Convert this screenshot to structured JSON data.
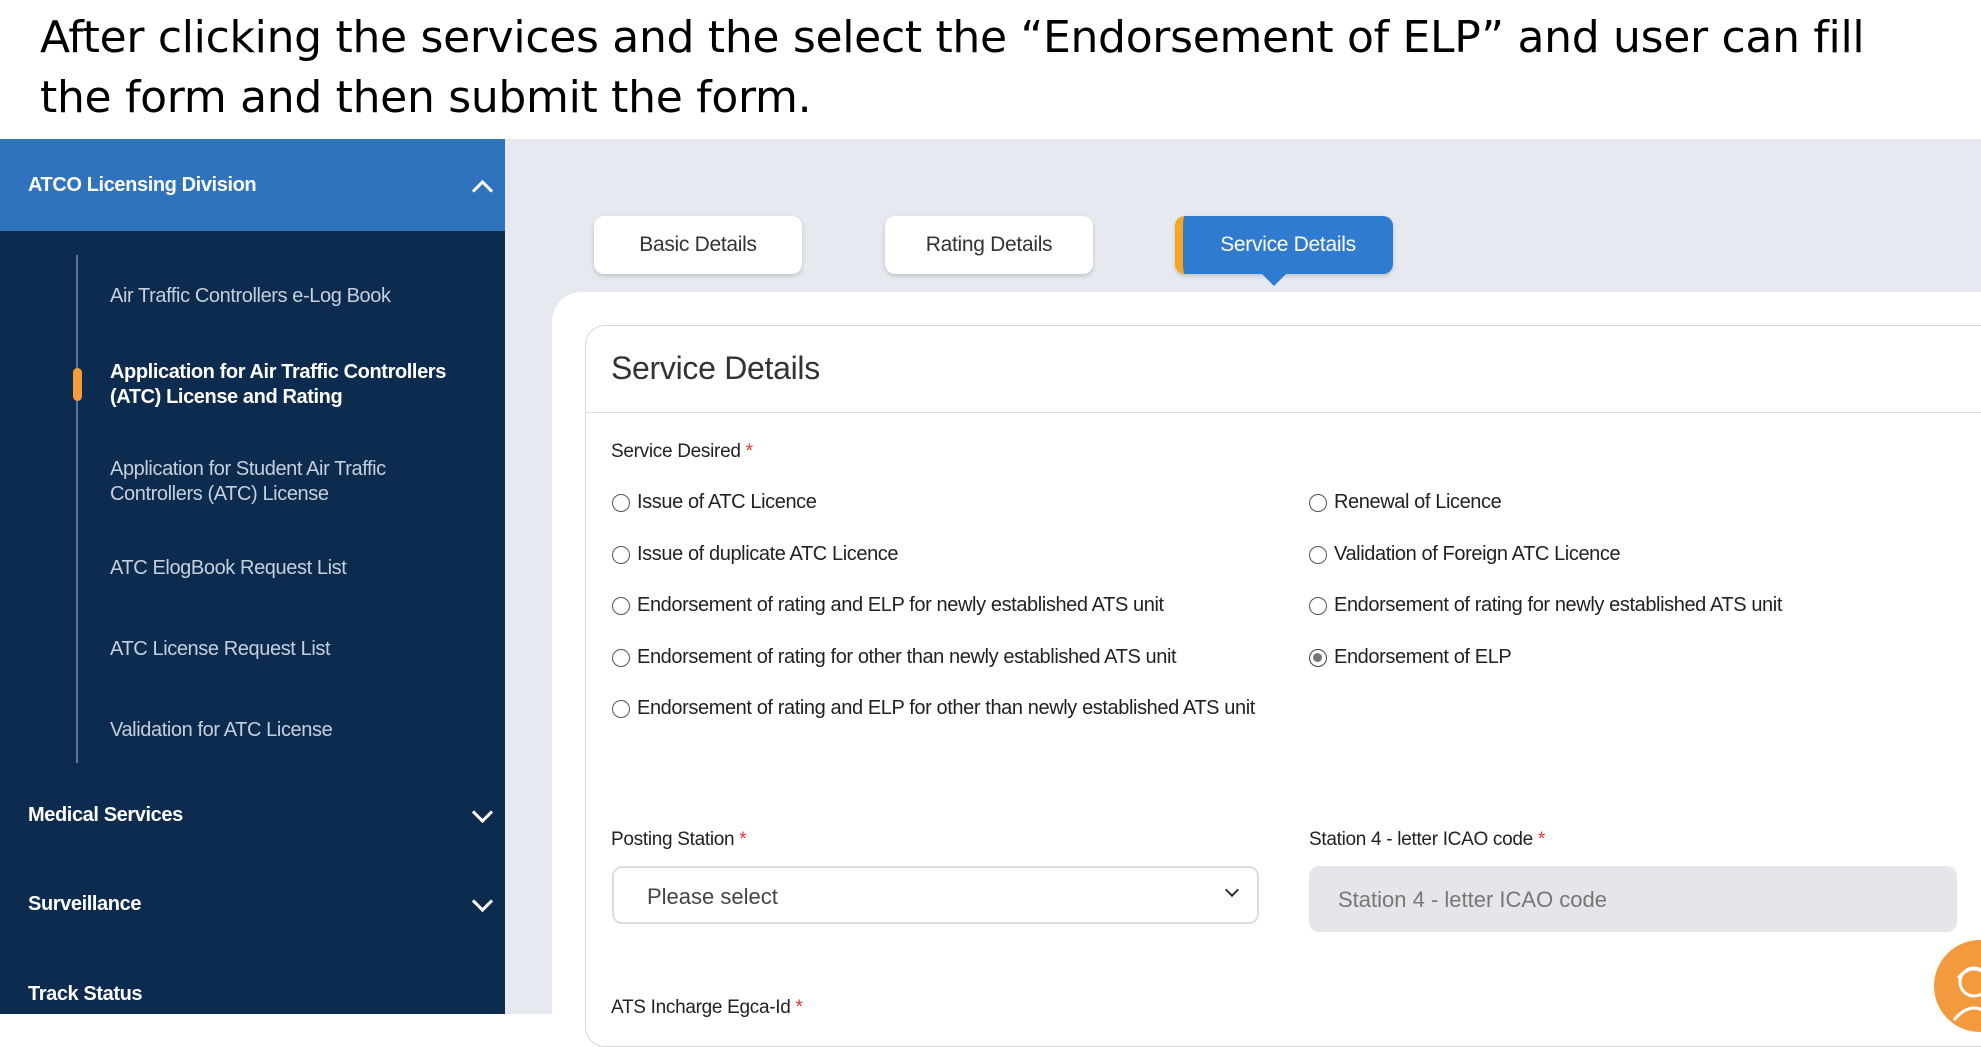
{
  "caption": "After clicking the services and the select the “Endorsement of ELP” and user can fill the form and then submit the form.",
  "sidebar": {
    "section_title": "ATCO Licensing Division",
    "sub_items": [
      {
        "label": "Air Traffic Controllers e-Log Book",
        "active": false
      },
      {
        "label": "Application for Air Traffic Controllers (ATC) License and Rating",
        "active": true
      },
      {
        "label": "Application for Student Air Traffic Controllers (ATC) License",
        "active": false
      },
      {
        "label": "ATC ElogBook Request List",
        "active": false
      },
      {
        "label": "ATC License Request List",
        "active": false
      },
      {
        "label": "Validation for ATC License",
        "active": false
      }
    ],
    "items": [
      {
        "label": "Medical Services"
      },
      {
        "label": "Surveillance"
      },
      {
        "label": "Track Status"
      }
    ]
  },
  "tabs": [
    {
      "label": "Basic Details",
      "active": false
    },
    {
      "label": "Rating Details",
      "active": false
    },
    {
      "label": "Service Details",
      "active": true
    }
  ],
  "form": {
    "title": "Service Details",
    "service_desired_label": "Service Desired",
    "required_mark": "*",
    "options": [
      {
        "label": "Issue of ATC Licence",
        "checked": false
      },
      {
        "label": "Renewal of Licence",
        "checked": false
      },
      {
        "label": "Issue of duplicate ATC Licence",
        "checked": false
      },
      {
        "label": "Validation of Foreign ATC Licence",
        "checked": false
      },
      {
        "label": "Endorsement of rating and ELP for newly established ATS unit",
        "checked": false
      },
      {
        "label": "Endorsement of rating for newly established ATS unit",
        "checked": false
      },
      {
        "label": "Endorsement of rating for other than newly established ATS unit",
        "checked": false
      },
      {
        "label": "Endorsement of ELP",
        "checked": true
      },
      {
        "label": "Endorsement of rating and ELP for other than newly established ATS unit",
        "checked": false
      }
    ],
    "posting_station_label": "Posting Station",
    "posting_station_value": "Please select",
    "icao_label": "Station 4 - letter ICAO code",
    "icao_placeholder": "Station 4 - letter ICAO code",
    "ats_incharge_label": "ATS Incharge Egca-Id"
  },
  "colors": {
    "sidebar_bg": "#0d2a4f",
    "sidebar_header": "#2f73bd",
    "accent": "#f39c3a",
    "tab_active": "#2f7bd0"
  }
}
